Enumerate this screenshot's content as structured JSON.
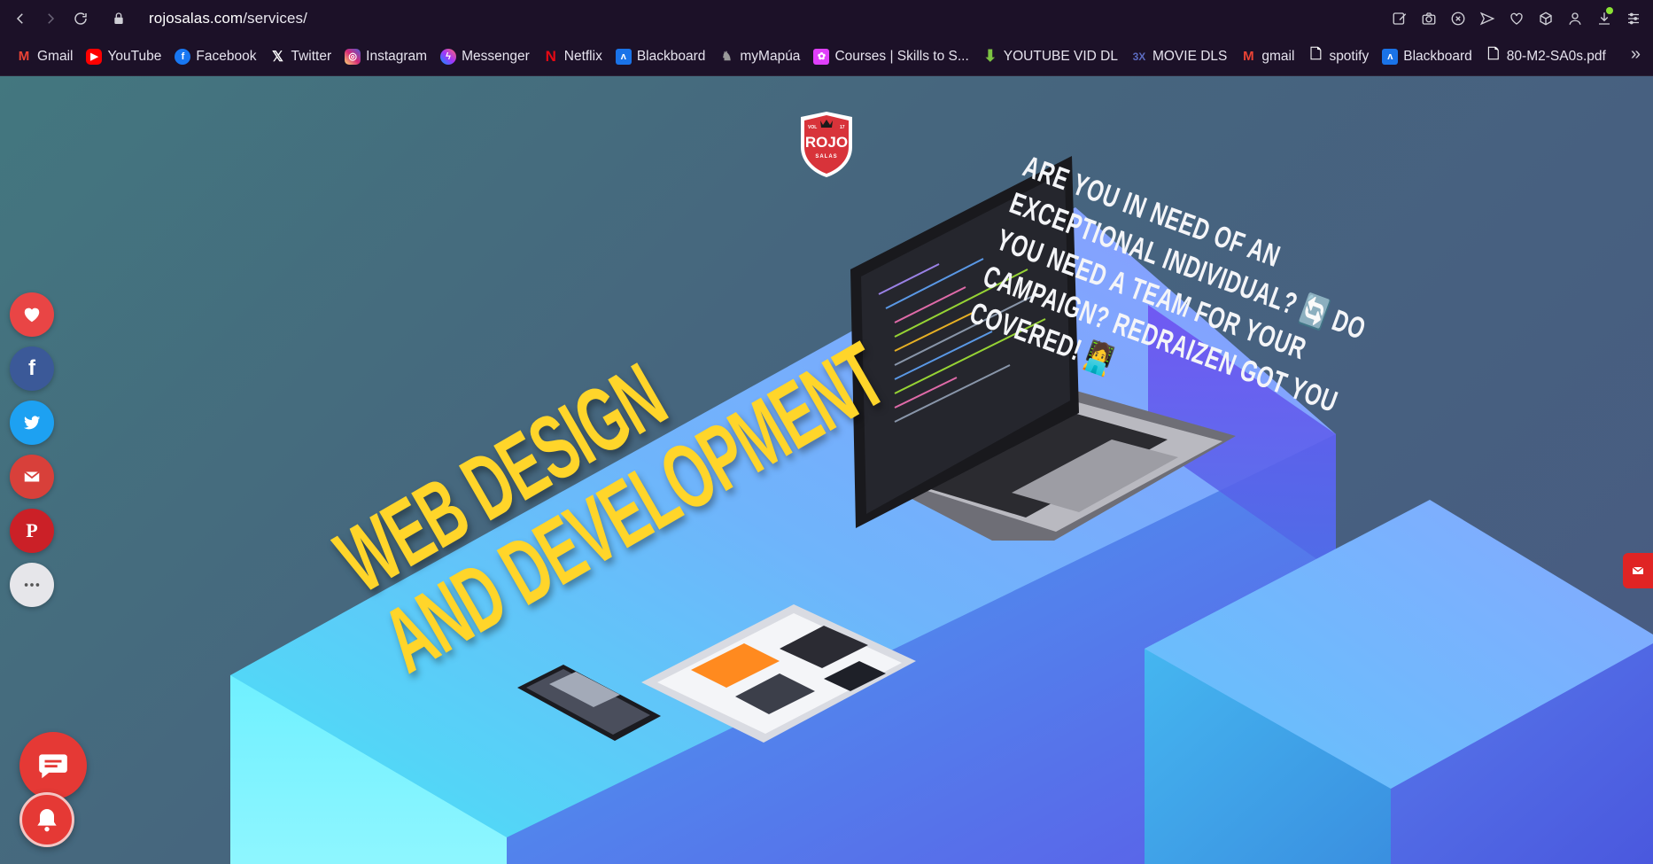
{
  "browser": {
    "url_host": "rojosalas.com",
    "url_path": "/services/",
    "bookmarks": [
      {
        "label": "Gmail",
        "icon": "gmail-icon",
        "color": "#ea4335"
      },
      {
        "label": "YouTube",
        "icon": "youtube-icon",
        "color": "#ff0000"
      },
      {
        "label": "Facebook",
        "icon": "facebook-icon",
        "color": "#1877f2"
      },
      {
        "label": "Twitter",
        "icon": "x-icon",
        "color": "#000000"
      },
      {
        "label": "Instagram",
        "icon": "instagram-icon",
        "color": "#d62976"
      },
      {
        "label": "Messenger",
        "icon": "messenger-icon",
        "color": "#7b5cff"
      },
      {
        "label": "Netflix",
        "icon": "netflix-icon",
        "color": "#e50914"
      },
      {
        "label": "Blackboard",
        "icon": "blackboard-icon",
        "color": "#1a73e8"
      },
      {
        "label": "myMapúa",
        "icon": "mymapua-icon",
        "color": "#8a8a8a"
      },
      {
        "label": "Courses | Skills to S...",
        "icon": "courses-icon",
        "color": "#e040fb"
      },
      {
        "label": "YOUTUBE VID DL",
        "icon": "download-arrow-icon",
        "color": "#7cc242"
      },
      {
        "label": "MOVIE DLS",
        "icon": "3x-icon",
        "color": "#3f51b5"
      },
      {
        "label": "gmail",
        "icon": "gmail-icon",
        "color": "#ea4335"
      },
      {
        "label": "spotify",
        "icon": "file-icon",
        "color": "#ffffff"
      },
      {
        "label": "Blackboard",
        "icon": "blackboard-icon",
        "color": "#1a73e8"
      },
      {
        "label": "80-M2-SA0s.pdf",
        "icon": "file-icon",
        "color": "#ffffff"
      }
    ]
  },
  "hero": {
    "logo_text": "ROJO",
    "logo_sub": "SALAS",
    "logo_left": "VOL",
    "logo_right": "17",
    "headline_line1": "WEB DESIGN",
    "headline_line2": "AND DEVELOPMENT",
    "tagline": "ARE YOU IN NEED OF AN EXCEPTIONAL INDIVIDUAL? 🔄 DO YOU NEED A TEAM FOR YOUR CAMPAIGN? REDRAIZEN GOT YOU COVERED! 🧑‍💻"
  },
  "social": [
    {
      "name": "heart",
      "color": "#e94545"
    },
    {
      "name": "facebook",
      "color": "#3b5998",
      "glyph": "f"
    },
    {
      "name": "twitter",
      "color": "#1da1f2"
    },
    {
      "name": "email",
      "color": "#d8403a"
    },
    {
      "name": "pinterest",
      "color": "#cb2027",
      "glyph": "P"
    },
    {
      "name": "more",
      "color": "#e6e6ea"
    }
  ],
  "colors": {
    "accent_yellow": "#ffd52a",
    "brand_red": "#e53935"
  }
}
